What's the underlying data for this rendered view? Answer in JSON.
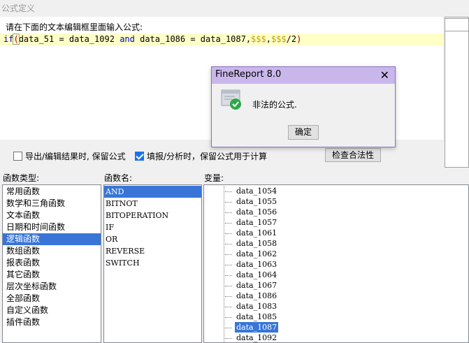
{
  "window": {
    "title": "公式定义"
  },
  "editor": {
    "prompt": "请在下面的文本编辑框里面输入公式:",
    "code": {
      "kw_if": "if",
      "open_paren": "(",
      "part1": "data_51 = data_1092 ",
      "kw_and": "and",
      "part2": " data_1086 = data_1087,",
      "str1": "$$$",
      "comma": ",",
      "str2": "$$$",
      "tail": "/2",
      "close_paren": ")"
    }
  },
  "options": {
    "export_keep": {
      "label": "导出/编辑结果时, 保留公式",
      "checked": false
    },
    "fill_keep": {
      "label": "填报/分析时，保留公式用于计算",
      "checked": true
    },
    "check_button": "检查合法性"
  },
  "sections": {
    "func_type_label": "函数类型:",
    "func_name_label": "函数名:",
    "var_label": "变量:"
  },
  "func_types": [
    {
      "label": "常用函数",
      "selected": false
    },
    {
      "label": "数学和三角函数",
      "selected": false
    },
    {
      "label": "文本函数",
      "selected": false
    },
    {
      "label": "日期和时间函数",
      "selected": false
    },
    {
      "label": "逻辑函数",
      "selected": true
    },
    {
      "label": "数组函数",
      "selected": false
    },
    {
      "label": "报表函数",
      "selected": false
    },
    {
      "label": "其它函数",
      "selected": false
    },
    {
      "label": "层次坐标函数",
      "selected": false
    },
    {
      "label": "全部函数",
      "selected": false
    },
    {
      "label": "自定义函数",
      "selected": false
    },
    {
      "label": "插件函数",
      "selected": false
    }
  ],
  "func_names": [
    {
      "label": "AND",
      "selected": true
    },
    {
      "label": "BITNOT",
      "selected": false
    },
    {
      "label": "BITOPERATION",
      "selected": false
    },
    {
      "label": "IF",
      "selected": false
    },
    {
      "label": "OR",
      "selected": false
    },
    {
      "label": "REVERSE",
      "selected": false
    },
    {
      "label": "SWITCH",
      "selected": false
    }
  ],
  "variables": [
    {
      "label": "data_1054",
      "selected": false
    },
    {
      "label": "data_1055",
      "selected": false
    },
    {
      "label": "data_1056",
      "selected": false
    },
    {
      "label": "data_1057",
      "selected": false
    },
    {
      "label": "data_1061",
      "selected": false
    },
    {
      "label": "data_1058",
      "selected": false
    },
    {
      "label": "data_1062",
      "selected": false
    },
    {
      "label": "data_1063",
      "selected": false
    },
    {
      "label": "data_1064",
      "selected": false
    },
    {
      "label": "data_1067",
      "selected": false
    },
    {
      "label": "data_1086",
      "selected": false
    },
    {
      "label": "data_1083",
      "selected": false
    },
    {
      "label": "data_1085",
      "selected": false
    },
    {
      "label": "data_1087",
      "selected": true
    },
    {
      "label": "data_1092",
      "selected": false
    }
  ],
  "dialog": {
    "title": "FineReport 8.0",
    "close_glyph": "✕",
    "message": "非法的公式.",
    "ok_button": "确定",
    "icon": "document-check-icon"
  },
  "colors": {
    "selection": "#3875d7",
    "dialog_title_bg": "#c9b7ec",
    "code_line_bg": "#ffffc8",
    "keyword": "#0000c0",
    "string": "#c0a000"
  }
}
